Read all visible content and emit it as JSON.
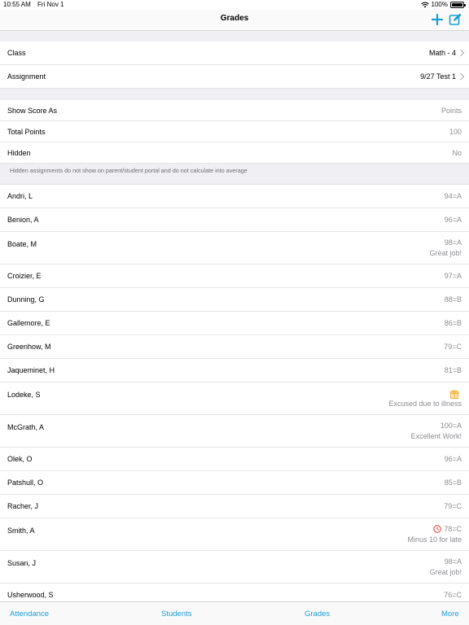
{
  "status": {
    "time": "10:55 AM",
    "date": "Fri Nov 1",
    "battery": "100%",
    "battery_level": 1.0
  },
  "nav": {
    "title": "Grades"
  },
  "assignment": {
    "class_label": "Class",
    "class_value": "Math - 4",
    "assignment_label": "Assignment",
    "assignment_value": "9/27 Test 1"
  },
  "settings": {
    "show_score_label": "Show Score As",
    "show_score_value": "Points",
    "total_points_label": "Total Points",
    "total_points_value": "100",
    "hidden_label": "Hidden",
    "hidden_value": "No",
    "note": "Hidden assignments do not show on parent/student portal and do not calculate into average"
  },
  "students": [
    {
      "name": "Andri, L",
      "score": "94=A",
      "comment": ""
    },
    {
      "name": "Benion, A",
      "score": "96=A",
      "comment": ""
    },
    {
      "name": "Boate, M",
      "score": "98=A",
      "comment": "Great job!"
    },
    {
      "name": "Croizier, E",
      "score": "97=A",
      "comment": ""
    },
    {
      "name": "Dunning, G",
      "score": "88=B",
      "comment": ""
    },
    {
      "name": "Gallemore, E",
      "score": "86=B",
      "comment": ""
    },
    {
      "name": "Greenhow, M",
      "score": "79=C",
      "comment": ""
    },
    {
      "name": "Jaqueminet, H",
      "score": "81=B",
      "comment": ""
    },
    {
      "name": "Lodeke, S",
      "score": "",
      "comment": "Excused due to illness",
      "icon": "gift-icon"
    },
    {
      "name": "McGrath, A",
      "score": "100=A",
      "comment": "Excellent Work!"
    },
    {
      "name": "Olek, O",
      "score": "96=A",
      "comment": ""
    },
    {
      "name": "Patshull, O",
      "score": "85=B",
      "comment": ""
    },
    {
      "name": "Racher, J",
      "score": "79=C",
      "comment": ""
    },
    {
      "name": "Smith, A",
      "score": "78=C",
      "comment": "Minus 10 for late",
      "icon": "late-clock-icon"
    },
    {
      "name": "Susan, J",
      "score": "98=A",
      "comment": "Great job!"
    },
    {
      "name": "Usherwood, S",
      "score": "76=C",
      "comment": ""
    }
  ],
  "tabs": {
    "attendance": "Attendance",
    "students": "Students",
    "grades": "Grades",
    "more": "More"
  },
  "colors": {
    "accent": "#1a9fd6",
    "late": "#e53935",
    "excused": "#f0a830"
  },
  "icons": {
    "add": "plus-icon",
    "edit": "edit-icon",
    "chevron": "chevron-right-icon",
    "wifi": "wifi-icon",
    "battery": "battery-icon"
  }
}
